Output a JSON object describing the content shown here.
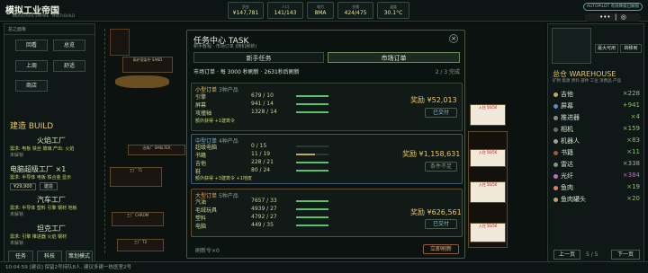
{
  "header": {
    "title": "模拟工业帝国",
    "subtitle": "INDUSTRIAL EMPIRE · MULTI-BUILD",
    "resources": [
      {
        "label": "资金",
        "value": "¥147,781"
      },
      {
        "label": "人口",
        "value": "141/143"
      },
      {
        "label": "电力",
        "value": "8MA"
      },
      {
        "label": "仓储",
        "value": "424/475"
      },
      {
        "label": "温度",
        "value": "30.1°C"
      }
    ],
    "autopilot": "AUTOPILOT 有效降级已解锁"
  },
  "left": {
    "section": "总之面板",
    "buttons": [
      "回看",
      "总览",
      "上周",
      "舒适",
      "商店"
    ],
    "build_title": "建造 BUILD",
    "items": [
      {
        "name": "火焰工厂",
        "desc": "需求: 电板 铁丝 玻璃  产出: 火焰",
        "status": "未解锁"
      },
      {
        "name": "电脑超级工厂 ×1",
        "desc": "需求: 半导体 电板 铁合金 显示",
        "status": "",
        "price": "¥29,900",
        "btn": "建造"
      },
      {
        "name": "汽车工厂",
        "desc": "需求: 半导体 塑料 引擎 钢材 地板",
        "status": "未解锁"
      },
      {
        "name": "坦克工厂",
        "desc": "需求: 引擎 推进器 火焰 钢材",
        "status": "未解锁"
      }
    ],
    "bottom_buttons": [
      "任务",
      "科技",
      "策划模式"
    ]
  },
  "map": {
    "labels": [
      "高炉渲染中 SAND",
      "冶炼厂 SMELTER",
      "工厂 T1",
      "工厂 CHROM",
      "工厂 T2"
    ]
  },
  "modal": {
    "title": "任务中心  TASK",
    "subtitle": "新手教程 · 市场订单 (随机刷新)",
    "tabs": [
      "新手任务",
      "市场订单"
    ],
    "info": "市场订单 · 每 3000 秒刷新 · 2631秒后刷新",
    "progress": "2 / 3 完成",
    "orders": [
      {
        "tier": "小型订单",
        "count": "3种产品",
        "reward": "奖励 ¥52,013",
        "button": "已交付",
        "rows": [
          {
            "name": "引擎",
            "qty": "679 / 10",
            "fill": 1
          },
          {
            "name": "屏幕",
            "qty": "941 / 14",
            "fill": 1
          },
          {
            "name": "攻撞轴",
            "qty": "1328 / 14",
            "fill": 1
          }
        ],
        "extra": "额外获得 +1建筑令"
      },
      {
        "tier": "中型订单",
        "count": "4种产品",
        "reward": "奖励 ¥1,158,631",
        "button": "条件不足",
        "rows": [
          {
            "name": "超级电脑",
            "qty": "0 / 15",
            "fill": 0
          },
          {
            "name": "书籍",
            "qty": "11 / 19",
            "fill": 0.58
          },
          {
            "name": "吉他",
            "qty": "228 / 21",
            "fill": 1
          },
          {
            "name": "鞋",
            "qty": "80 / 24",
            "fill": 1
          }
        ],
        "extra": "额外获得 +3建筑令 +1地皮"
      },
      {
        "tier": "大型订单",
        "count": "5种产品",
        "reward": "奖励 ¥626,561",
        "button": "已交付",
        "rows": [
          {
            "name": "汽油",
            "qty": "7657 / 33",
            "fill": 1
          },
          {
            "name": "毛绒玩具",
            "qty": "4939 / 27",
            "fill": 1
          },
          {
            "name": "塑料",
            "qty": "4792 / 27",
            "fill": 1
          },
          {
            "name": "电脑",
            "qty": "449 / 35",
            "fill": 1
          }
        ],
        "extra": ""
      }
    ],
    "footer": "刷新令×0",
    "refresh_btn": "立即刷新"
  },
  "right": {
    "wh_title": "总仓 WAREHOUSE",
    "wh_sub": "矿物 能源 原料 部件 工业 消费品 产品",
    "side_buttons": [
      "最大可用",
      "转移到"
    ],
    "items": [
      {
        "name": "吉他",
        "count": "×228"
      },
      {
        "name": "屏幕",
        "count": "+941"
      },
      {
        "name": "推进器",
        "count": "×4"
      },
      {
        "name": "相机",
        "count": "×159"
      },
      {
        "name": "机器人",
        "count": "×83"
      },
      {
        "name": "书籍",
        "count": "×11"
      },
      {
        "name": "雷达",
        "count": "×338"
      },
      {
        "name": "光纤",
        "count": "×384"
      },
      {
        "name": "鱼肉",
        "count": "×19"
      },
      {
        "name": "鱼肉罐头",
        "count": "×20"
      }
    ],
    "prev": "上一页",
    "page": "5 / 5",
    "next": "下一页"
  },
  "footer": {
    "log": "10:04:59  [建议] 保留2号持队8人, 建议多建一栋医室2号"
  }
}
